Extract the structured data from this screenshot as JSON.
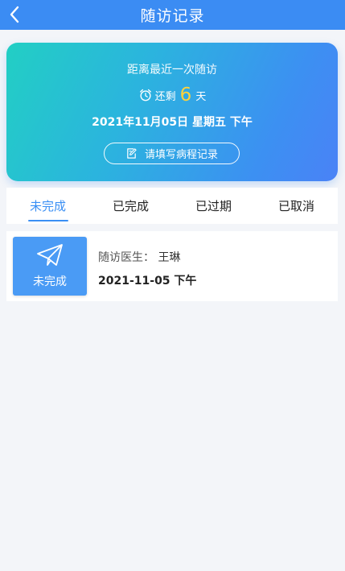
{
  "header": {
    "title": "随访记录",
    "back_icon": "chevron-left-icon"
  },
  "card": {
    "subtitle": "距离最近一次随访",
    "remain_prefix": "还剩",
    "remain_days": "6",
    "remain_suffix": "天",
    "date": "2021年11月05日 星期五 下午",
    "fill_button": "请填写病程记录",
    "gradient_start": "#22cfc4",
    "gradient_end": "#4a82f6",
    "days_color": "#ffd23a"
  },
  "tabs": [
    {
      "label": "未完成",
      "active": true
    },
    {
      "label": "已完成",
      "active": false
    },
    {
      "label": "已过期",
      "active": false
    },
    {
      "label": "已取消",
      "active": false
    }
  ],
  "records": [
    {
      "status": "未完成",
      "status_icon": "paper-plane-icon",
      "doctor_label": "随访医生：",
      "doctor_name": "王琳",
      "date": "2021-11-05 下午"
    }
  ],
  "colors": {
    "primary": "#3b8cf3",
    "background": "#f3f5f9"
  }
}
